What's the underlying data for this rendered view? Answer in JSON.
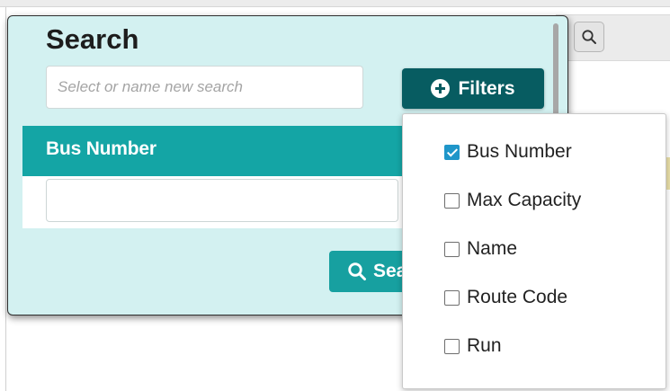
{
  "panel": {
    "title": "Search",
    "search_name": {
      "placeholder": "Select or name new search",
      "value": ""
    },
    "filters_button": {
      "label": "Filters",
      "icon": "plus-circle-icon"
    },
    "field": {
      "header": "Bus Number",
      "value": ""
    },
    "search_button": {
      "label": "Search",
      "icon": "search-icon"
    }
  },
  "filter_menu": {
    "items": [
      {
        "label": "Bus Number",
        "checked": true
      },
      {
        "label": "Max Capacity",
        "checked": false
      },
      {
        "label": "Name",
        "checked": false
      },
      {
        "label": "Route Code",
        "checked": false
      },
      {
        "label": "Run",
        "checked": false
      }
    ]
  },
  "colors": {
    "panel_background": "#d3f1f1",
    "accent_dark": "#075c61",
    "accent_teal": "#14a5a5",
    "checkbox_checked": "#1f96c9"
  }
}
